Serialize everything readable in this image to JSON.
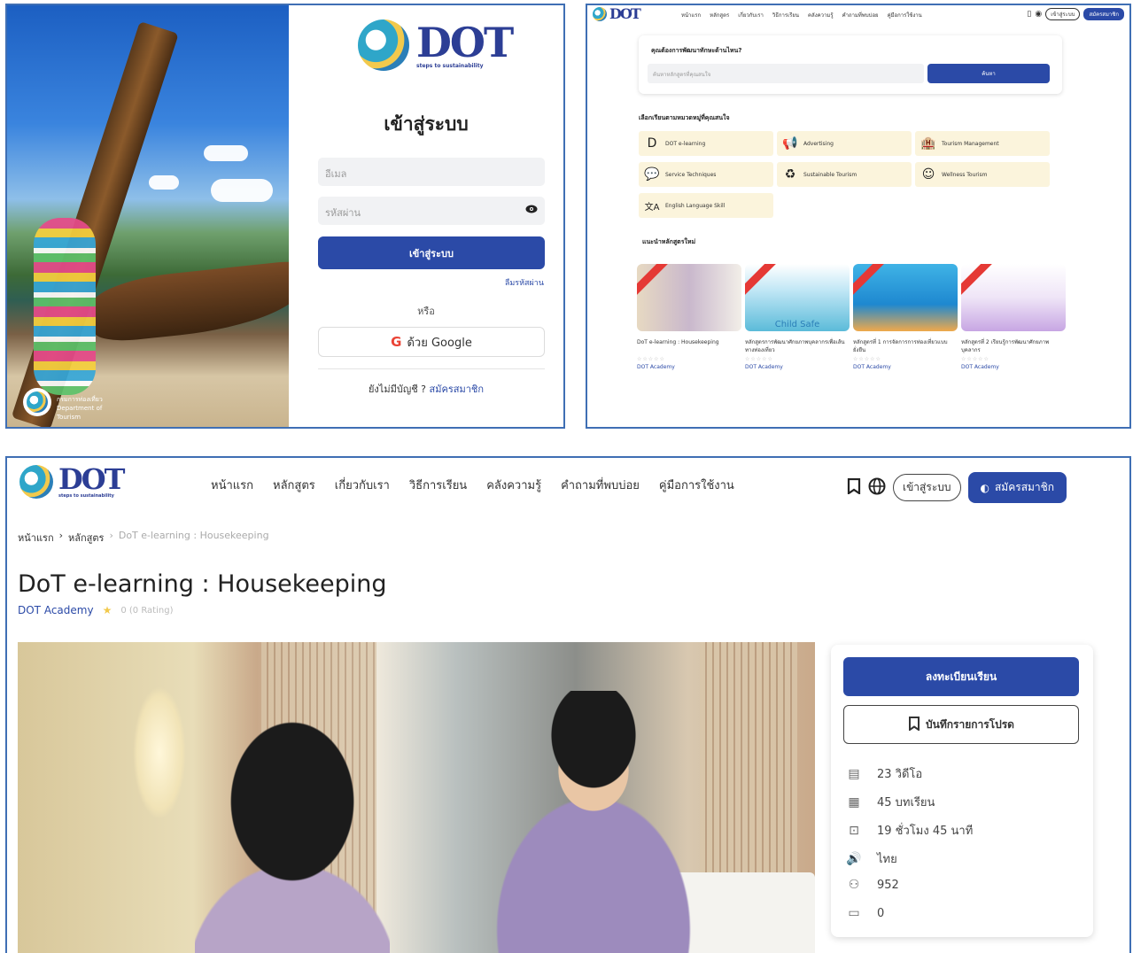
{
  "login_panel": {
    "logo_text": "DOT",
    "logo_tagline": "steps to sustainability",
    "heading": "เข้าสู่ระบบ",
    "email_placeholder": "อีเมล",
    "password_placeholder": "รหัสผ่าน",
    "login_button": "เข้าสู่ระบบ",
    "forgot_password": "ลืมรหัสผ่าน",
    "or_text": "หรือ",
    "google_button": "ด้วย Google",
    "no_account": "ยังไม่มีบัญชี ?",
    "signup_link": "สมัครสมาชิก",
    "scene_caption": "กรมการท่องเที่ยว Department of Tourism"
  },
  "home_panel": {
    "nav_items": [
      "หน้าแรก",
      "หลักสูตร",
      "เกี่ยวกับเรา",
      "วิธีการเรียน",
      "คลังความรู้",
      "คำถามที่พบบ่อย",
      "คู่มือการใช้งาน"
    ],
    "login_pill": "เข้าสู่ระบบ",
    "signup_pill": "สมัครสมาชิก",
    "search_question": "คุณต้องการพัฒนาทักษะด้านไหน?",
    "search_placeholder": "ค้นหาหลักสูตรที่คุณสนใจ",
    "search_button": "ค้นหา",
    "categories_title": "เลือกเรียนตามหมวดหมู่ที่คุณสนใจ",
    "categories": [
      {
        "icon": "D",
        "label": "DOT e-learning"
      },
      {
        "icon": "📢",
        "label": "Advertising"
      },
      {
        "icon": "🏨",
        "label": "Tourism Management"
      },
      {
        "icon": "💬",
        "label": "Service Techniques"
      },
      {
        "icon": "♻",
        "label": "Sustainable Tourism"
      },
      {
        "icon": "☺",
        "label": "Wellness Tourism"
      },
      {
        "icon": "文A",
        "label": "English Language Skill"
      }
    ],
    "recommended_title": "แนะนำหลักสูตรใหม่",
    "courses": [
      {
        "name": "DoT e-learning : Housekeeping",
        "academy": "DOT Academy",
        "rating": "☆☆☆☆☆"
      },
      {
        "name": "หลักสูตรการพัฒนาศักยภาพบุคลากรเพื่อเส้นทางท่องเที่ยว",
        "academy": "DOT Academy",
        "rating": "☆☆☆☆☆"
      },
      {
        "name": "หลักสูตรที่ 1 การจัดการการท่องเที่ยวแบบยั่งยืน",
        "academy": "DOT Academy",
        "rating": "☆☆☆☆☆"
      },
      {
        "name": "หลักสูตรที่ 2 เรียนรู้การพัฒนาศักยภาพบุคลากร",
        "academy": "DOT Academy",
        "rating": "☆☆☆☆☆"
      }
    ],
    "course2_thumb_label": "Child Safe"
  },
  "course_panel": {
    "nav_items": [
      "หน้าแรก",
      "หลักสูตร",
      "เกี่ยวกับเรา",
      "วิธีการเรียน",
      "คลังความรู้",
      "คำถามที่พบบ่อย",
      "คู่มือการใช้งาน"
    ],
    "login_button": "เข้าสู่ระบบ",
    "signup_button": "สมัครสมาชิก",
    "breadcrumb": [
      "หน้าแรก",
      "หลักสูตร",
      "DoT e-learning : Housekeeping"
    ],
    "title": "DoT e-learning : Housekeeping",
    "academy": "DOT Academy",
    "rating": "0 (0 Rating)",
    "enroll_button": "ลงทะเบียนเรียน",
    "save_button": "บันทึกรายการโปรด",
    "stats": [
      {
        "icon": "video-icon",
        "glyph": "▤",
        "value": "23 วิดีโอ"
      },
      {
        "icon": "lesson-icon",
        "glyph": "▦",
        "value": "45 บทเรียน"
      },
      {
        "icon": "duration-icon",
        "glyph": "⊡",
        "value": "19 ชั่วโมง 45 นาที"
      },
      {
        "icon": "language-icon",
        "glyph": "🔊",
        "value": "ไทย"
      },
      {
        "icon": "learners-icon",
        "glyph": "⚇",
        "value": "952"
      },
      {
        "icon": "comments-icon",
        "glyph": "▭",
        "value": "0"
      }
    ]
  },
  "colors": {
    "primary": "#2b4aa7",
    "frame": "#3f6fb4",
    "category_bg": "#fbf4dc"
  }
}
